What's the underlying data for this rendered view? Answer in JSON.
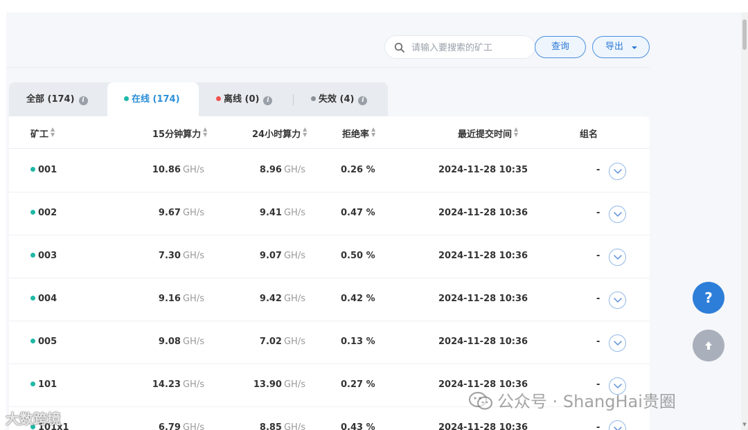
{
  "search": {
    "placeholder": "请输入要搜索的矿工"
  },
  "toolbar": {
    "query_label": "查询",
    "export_label": "导出"
  },
  "tabs": [
    {
      "label": "全部 (174)",
      "dot_color": null
    },
    {
      "label": "在线 (174)",
      "dot_color": "#1fb8a6"
    },
    {
      "label": "离线 (0)",
      "dot_color": "#ef5350"
    },
    {
      "label": "失效 (4)",
      "dot_color": "#8a9099"
    }
  ],
  "table": {
    "headers": [
      "矿工",
      "15分钟算力",
      "24小时算力",
      "拒绝率",
      "最近提交时间",
      "组名"
    ],
    "unit": "GH/s",
    "rows": [
      {
        "worker": "001",
        "h15": "10.86",
        "h24": "8.96",
        "reject": "0.26 %",
        "time": "2024-11-28 10:35",
        "group": "-"
      },
      {
        "worker": "002",
        "h15": "9.67",
        "h24": "9.41",
        "reject": "0.47 %",
        "time": "2024-11-28 10:36",
        "group": "-"
      },
      {
        "worker": "003",
        "h15": "7.30",
        "h24": "9.07",
        "reject": "0.50 %",
        "time": "2024-11-28 10:36",
        "group": "-"
      },
      {
        "worker": "004",
        "h15": "9.16",
        "h24": "9.42",
        "reject": "0.42 %",
        "time": "2024-11-28 10:36",
        "group": "-"
      },
      {
        "worker": "005",
        "h15": "9.08",
        "h24": "7.02",
        "reject": "0.13 %",
        "time": "2024-11-28 10:36",
        "group": "-"
      },
      {
        "worker": "101",
        "h15": "14.23",
        "h24": "13.90",
        "reject": "0.27 %",
        "time": "2024-11-28 10:36",
        "group": "-"
      },
      {
        "worker": "101x1",
        "h15": "6.79",
        "h24": "8.85",
        "reject": "0.43 %",
        "time": "2024-11-28 10:36",
        "group": "-"
      }
    ]
  },
  "fab": {
    "help_label": "?"
  },
  "watermarks": {
    "right": "公众号 · ShangHai贵圈",
    "left": "大数跨境"
  },
  "colors": {
    "accent": "#2c7ad6",
    "online": "#1fb8a6",
    "offline": "#ef5350",
    "invalid": "#8a9099"
  }
}
